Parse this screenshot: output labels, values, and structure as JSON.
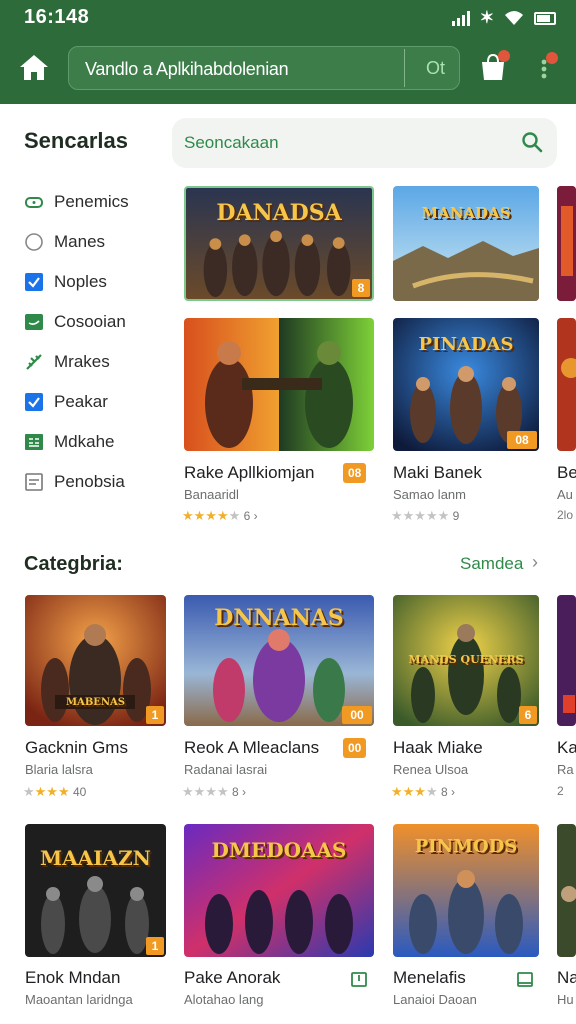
{
  "status_bar": {
    "time": "16:148",
    "bt": "✶"
  },
  "header": {
    "search_query": "Vandlo a Aplkihabdolenian",
    "search_action": "Ot"
  },
  "sidebar": {
    "title": "Sencarlas",
    "items": [
      {
        "label": "Penemics",
        "icon": "game-controller-icon"
      },
      {
        "label": "Manes",
        "icon": "circle-icon"
      },
      {
        "label": "Noples",
        "icon": "checkbox-checked-icon"
      },
      {
        "label": "Cosooian",
        "icon": "chat-icon"
      },
      {
        "label": "Mrakes",
        "icon": "leaf-icon"
      },
      {
        "label": "Peakar",
        "icon": "checkbox-checked-icon"
      },
      {
        "label": "Mdkahe",
        "icon": "grid-icon"
      },
      {
        "label": "Penobsia",
        "icon": "document-icon"
      }
    ]
  },
  "search": {
    "placeholder": "Seoncakaan"
  },
  "featured": {
    "tiles": [
      {
        "title": "DANADSA",
        "badge": "8"
      },
      {
        "title": "MANADAS",
        "badge": ""
      },
      {
        "title": "",
        "badge": ""
      }
    ],
    "apps": [
      {
        "title": "",
        "name": "Rake Apllkiomjan",
        "developer": "Banaaridl",
        "badge": "08",
        "rating": "6",
        "stars": 4
      },
      {
        "title": "PINADAS",
        "name": "Maki Banek",
        "developer": "Samao lanm",
        "badge": "08",
        "rating": "9",
        "stars": 0
      },
      {
        "title": "",
        "name": "Be",
        "developer": "Au",
        "badge": "",
        "rating": "2lo",
        "stars": 0
      }
    ]
  },
  "categories": {
    "title": "Categbria:",
    "see_all": "Samdea",
    "row1": [
      {
        "name": "Gacknin Gms",
        "developer": "Blaria lalsra",
        "rating": "40",
        "stars": 3,
        "badge": "1",
        "art_title": "MABENAS"
      },
      {
        "name": "Reok A Mleaclans",
        "developer": "Radanai lasrai",
        "rating": "8",
        "stars": 0,
        "badge": "00",
        "art_title": "DNNANAS"
      },
      {
        "name": "Haak Miake",
        "developer": "Renea Ulsoa",
        "rating": "8",
        "stars": 3,
        "badge": "6",
        "art_title": "MANDS QUENERS"
      },
      {
        "name": "Ka",
        "developer": "Ra",
        "rating": "2",
        "stars": 0,
        "badge": "",
        "art_title": ""
      }
    ],
    "row2": [
      {
        "name": "Enok Mndan",
        "developer": "Maoantan laridnga",
        "badge": "1",
        "art_title": "MAAIAZN"
      },
      {
        "name": "Pake Anorak",
        "developer": "Alotahao lang",
        "badge": "",
        "art_title": "DMEDOAAS"
      },
      {
        "name": "Menelafis",
        "developer": "Lanaioi Daoan",
        "badge": "",
        "art_title": "PINMODS"
      },
      {
        "name": "Na",
        "developer": "Hu",
        "badge": "",
        "art_title": ""
      }
    ]
  },
  "colors": {
    "header_bg": "#2e6b3a",
    "accent": "#2f8a4a",
    "badge": "#f09a24",
    "star": "#f2b02a"
  }
}
